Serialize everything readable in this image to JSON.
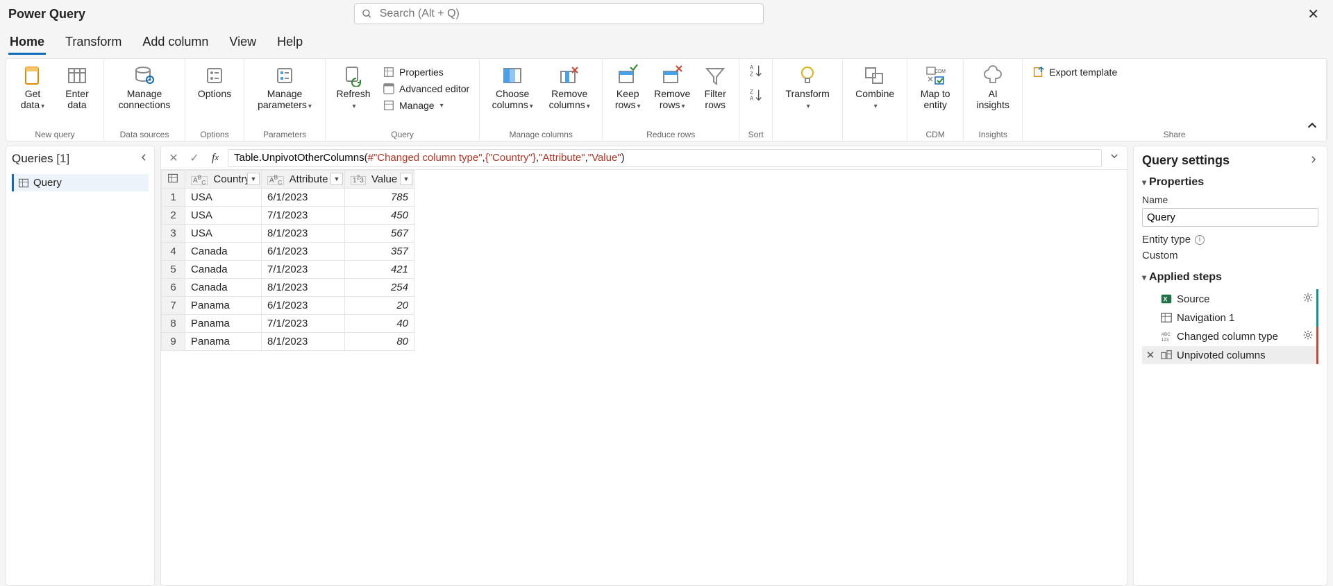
{
  "app_title": "Power Query",
  "search_placeholder": "Search (Alt + Q)",
  "menu_tabs": [
    "Home",
    "Transform",
    "Add column",
    "View",
    "Help"
  ],
  "active_tab_index": 0,
  "ribbon": {
    "groups": {
      "new_query": {
        "label": "New query",
        "get_data": "Get data",
        "enter_data": "Enter data"
      },
      "data_sources": {
        "label": "Data sources",
        "manage_connections": "Manage connections"
      },
      "options": {
        "label": "Options",
        "options_btn": "Options"
      },
      "parameters": {
        "label": "Parameters",
        "manage_parameters": "Manage parameters"
      },
      "query": {
        "label": "Query",
        "refresh": "Refresh",
        "properties": "Properties",
        "advanced": "Advanced editor",
        "manage": "Manage"
      },
      "manage_columns": {
        "label": "Manage columns",
        "choose": "Choose columns",
        "remove": "Remove columns"
      },
      "reduce_rows": {
        "label": "Reduce rows",
        "keep": "Keep rows",
        "remove": "Remove rows",
        "filter": "Filter rows"
      },
      "sort": {
        "label": "Sort"
      },
      "transform": {
        "label": "",
        "transform_btn": "Transform"
      },
      "combine": {
        "label": "",
        "combine_btn": "Combine"
      },
      "cdm": {
        "label": "CDM",
        "map_entity": "Map to entity"
      },
      "insights": {
        "label": "Insights",
        "ai": "AI insights"
      },
      "share": {
        "label": "Share",
        "export_template": "Export template"
      }
    }
  },
  "queries_pane": {
    "title": "Queries",
    "count": "[1]",
    "items": [
      "Query"
    ]
  },
  "formula": {
    "fn": "Table.UnpivotOtherColumns",
    "arg1": "#\"Changed column type\"",
    "arg2": "{\"Country\"}",
    "arg3": "\"Attribute\"",
    "arg4": "\"Value\""
  },
  "grid": {
    "columns": [
      {
        "name": "Country",
        "type": "ABC"
      },
      {
        "name": "Attribute",
        "type": "ABC"
      },
      {
        "name": "Value",
        "type": "123"
      }
    ],
    "rows": [
      {
        "n": "1",
        "c0": "USA",
        "c1": "6/1/2023",
        "c2": "785"
      },
      {
        "n": "2",
        "c0": "USA",
        "c1": "7/1/2023",
        "c2": "450"
      },
      {
        "n": "3",
        "c0": "USA",
        "c1": "8/1/2023",
        "c2": "567"
      },
      {
        "n": "4",
        "c0": "Canada",
        "c1": "6/1/2023",
        "c2": "357"
      },
      {
        "n": "5",
        "c0": "Canada",
        "c1": "7/1/2023",
        "c2": "421"
      },
      {
        "n": "6",
        "c0": "Canada",
        "c1": "8/1/2023",
        "c2": "254"
      },
      {
        "n": "7",
        "c0": "Panama",
        "c1": "6/1/2023",
        "c2": "20"
      },
      {
        "n": "8",
        "c0": "Panama",
        "c1": "7/1/2023",
        "c2": "40"
      },
      {
        "n": "9",
        "c0": "Panama",
        "c1": "8/1/2023",
        "c2": "80"
      }
    ]
  },
  "settings": {
    "title": "Query settings",
    "properties_header": "Properties",
    "name_label": "Name",
    "name_value": "Query",
    "entity_type_label": "Entity type",
    "entity_type_value": "Custom",
    "applied_steps_header": "Applied steps",
    "steps": [
      {
        "name": "Source",
        "gear": true,
        "accent": "teal",
        "icon": "xl"
      },
      {
        "name": "Navigation 1",
        "accent": "teal",
        "icon": "table"
      },
      {
        "name": "Changed column type",
        "gear": true,
        "accent": "red",
        "icon": "type"
      },
      {
        "name": "Unpivoted columns",
        "selected": true,
        "accent": "red",
        "icon": "unpivot",
        "deletable": true
      }
    ]
  }
}
